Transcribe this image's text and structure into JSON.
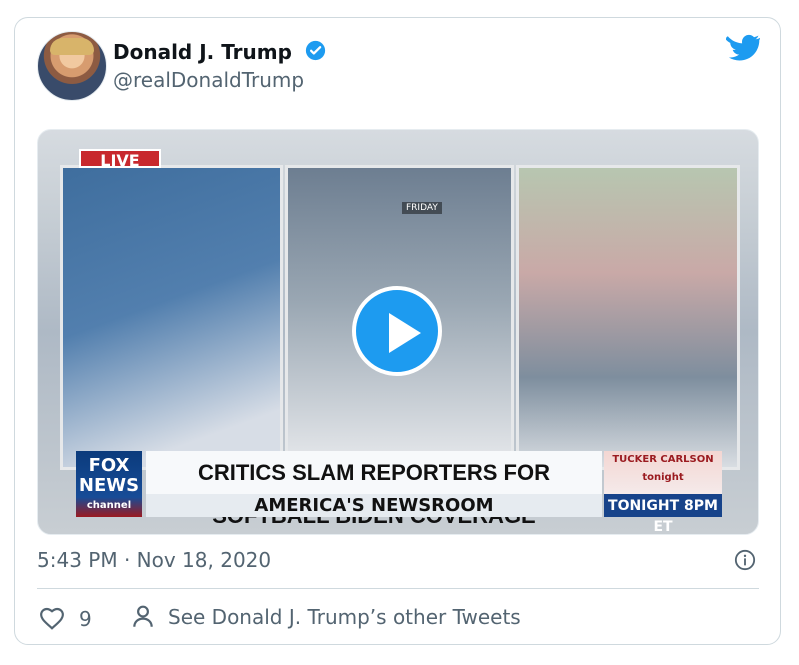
{
  "tweet": {
    "author_name": "Donald J. Trump",
    "handle": "@realDonaldTrump",
    "timestamp": "5:43 PM · Nov 18, 2020",
    "likes": "9",
    "other_tweets_text": "See Donald J. Trump’s other Tweets"
  },
  "media": {
    "live_label": "LIVE",
    "friday_label": "FRIDAY",
    "network_logo_top": "FOX",
    "network_logo_middle": "NEWS",
    "network_logo_bottom": "channel",
    "headline": "CRITICS SLAM REPORTERS FOR SOFTBALL BIDEN COVERAGE",
    "subheadline": "AMERICA'S NEWSROOM",
    "ad_show": "TUCKER CARLSON",
    "ad_show_sub": "tonight",
    "ad_time": "TONIGHT 8PM ET"
  },
  "colors": {
    "twitter_blue": "#1d9bf0",
    "text_secondary": "#536471",
    "border": "#cfd9de"
  },
  "icons": [
    "verified-badge-icon",
    "twitter-bird-icon",
    "play-icon",
    "info-icon",
    "heart-icon",
    "person-icon"
  ]
}
